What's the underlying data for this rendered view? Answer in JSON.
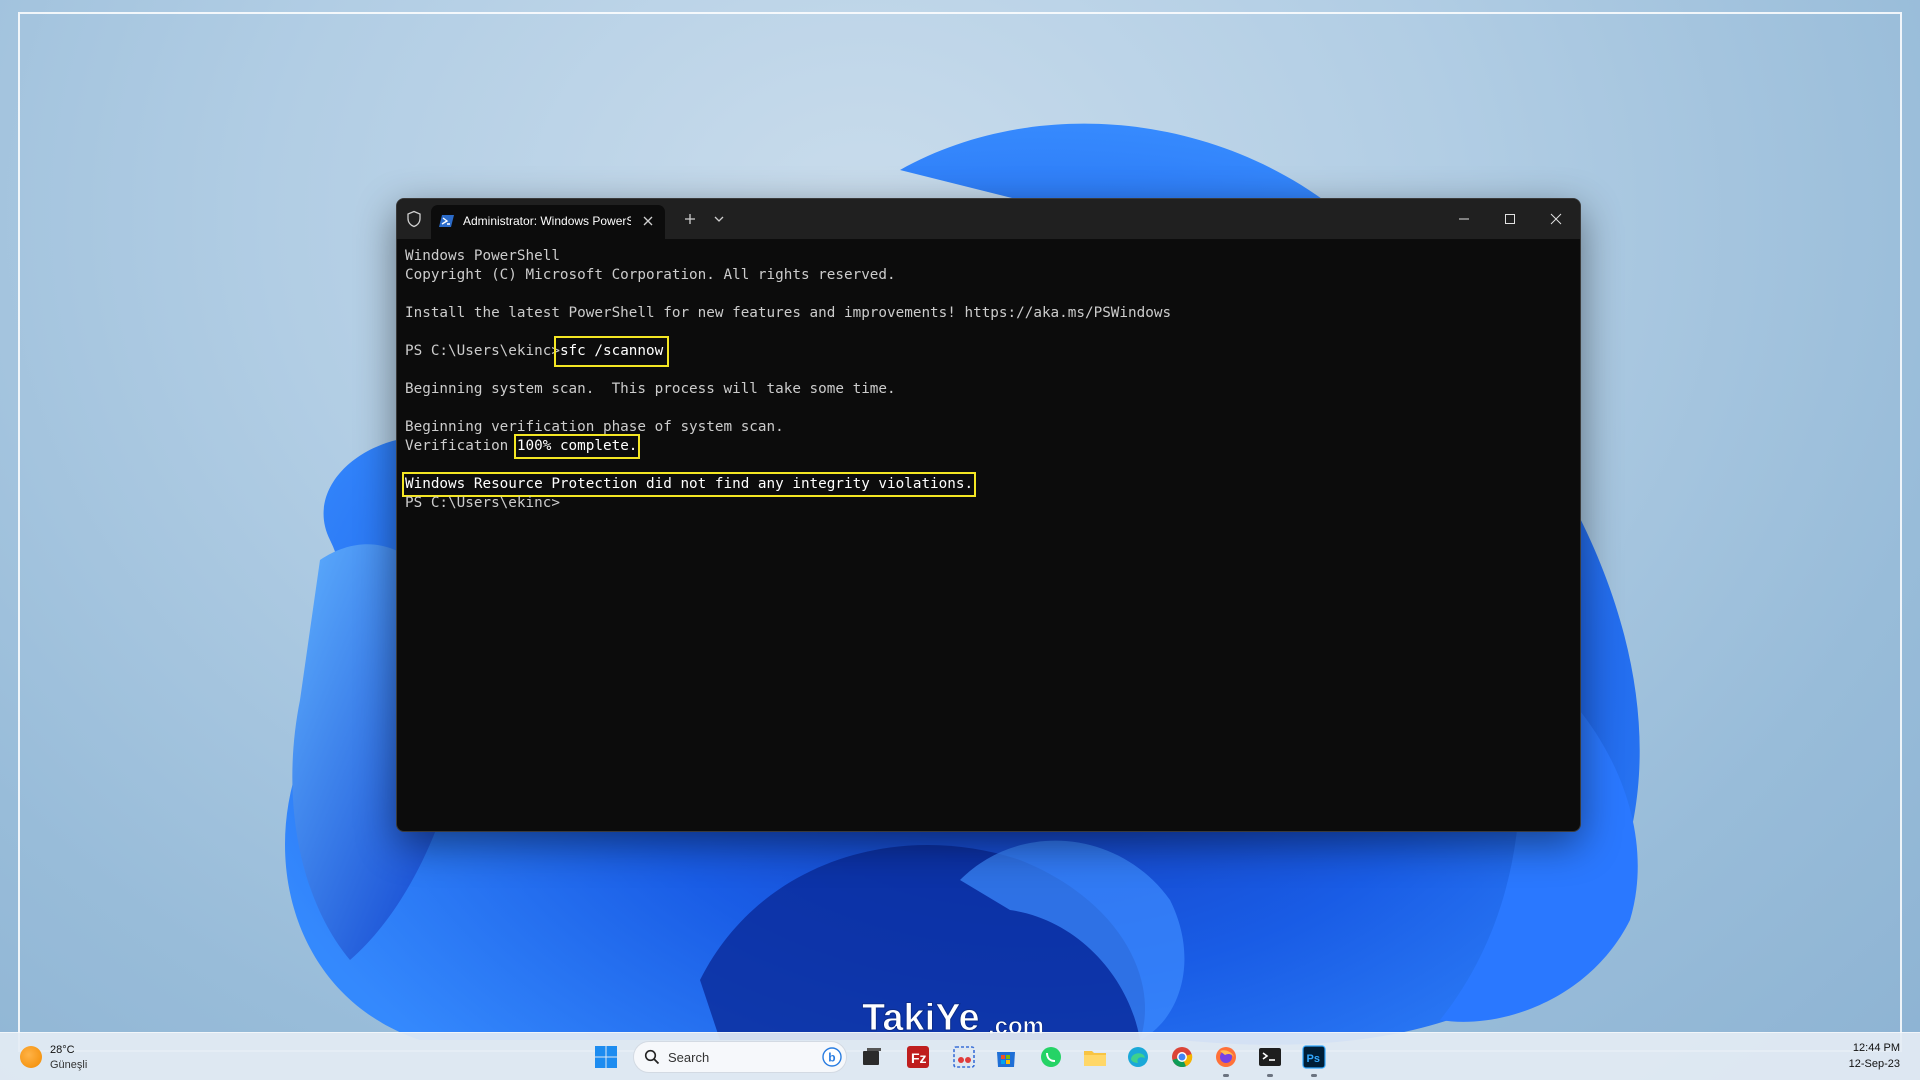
{
  "desktop": {
    "accent_color": "#1e66f5"
  },
  "terminal": {
    "tab_title": "Administrator: Windows PowerShell",
    "tab_icon": "powershell-icon",
    "lines": {
      "l1": "Windows PowerShell",
      "l2": "Copyright (C) Microsoft Corporation. All rights reserved.",
      "l3": "Install the latest PowerShell for new features and improvements! https://aka.ms/PSWindows",
      "prompt1": "PS C:\\Users\\ekinc>",
      "command": "sfc /scannow",
      "l5": "Beginning system scan.  This process will take some time.",
      "l6": "Beginning verification phase of system scan.",
      "verification_prefix": "Verification ",
      "verification_value": "100% complete.",
      "result": "Windows Resource Protection did not find any integrity violations.",
      "prompt2": "PS C:\\Users\\ekinc>"
    },
    "highlight_color": "#f4e623",
    "background_color": "#0c0c0c"
  },
  "watermark": {
    "brand": "TakiYe",
    "suffix": ".com"
  },
  "taskbar": {
    "weather_temp": "28°C",
    "weather_desc": "Güneşli",
    "search_placeholder": "Search",
    "icons": [
      "windows-start-icon",
      "task-view-icon",
      "filezilla-icon",
      "snipping-tool-icon",
      "microsoft-store-icon",
      "whatsapp-icon",
      "file-explorer-icon",
      "edge-icon",
      "chrome-icon",
      "firefox-icon",
      "terminal-icon",
      "photoshop-icon"
    ],
    "clock_time": "12:44 PM",
    "clock_date": "12-Sep-23"
  }
}
